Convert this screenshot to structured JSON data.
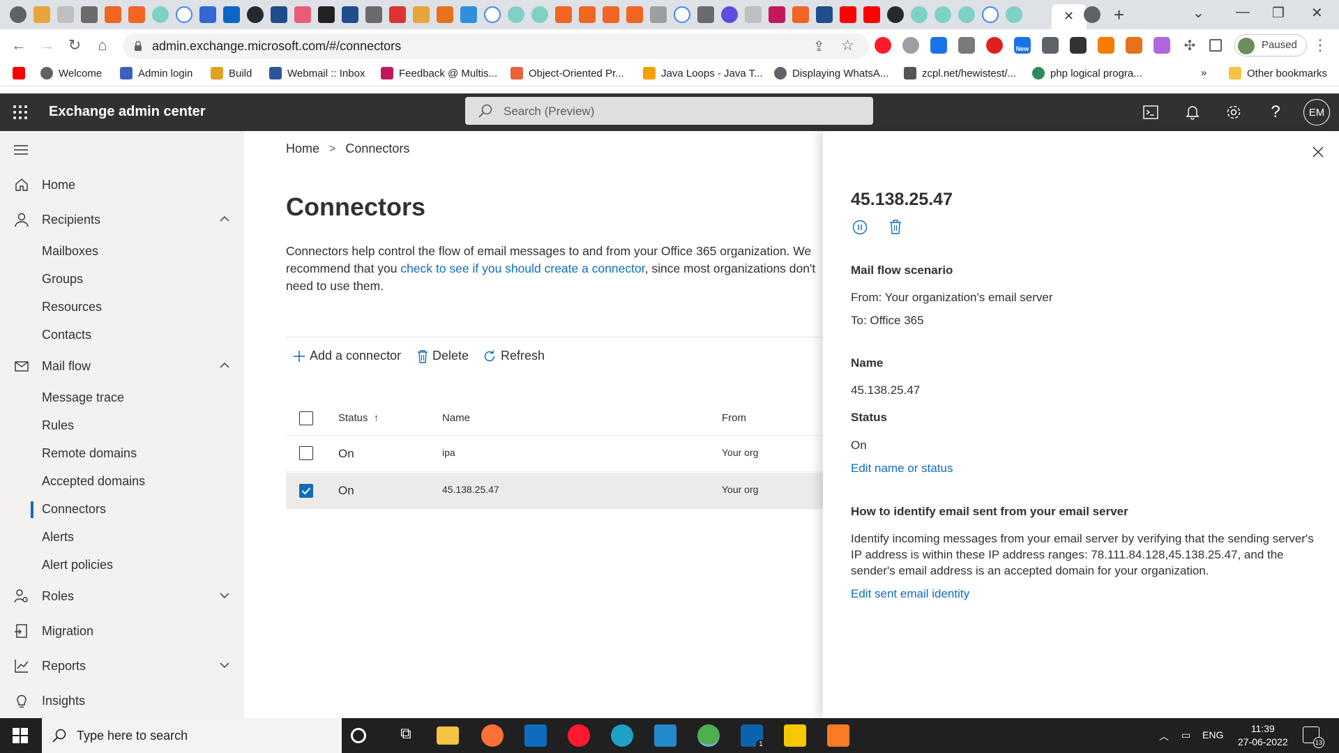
{
  "browser": {
    "url": "admin.exchange.microsoft.com/#/connectors",
    "profile_status": "Paused",
    "bookmarks": [
      {
        "label": "Welcome"
      },
      {
        "label": "Admin login"
      },
      {
        "label": "Build"
      },
      {
        "label": "Webmail :: Inbox"
      },
      {
        "label": "Feedback @ Multis..."
      },
      {
        "label": "Object-Oriented Pr..."
      },
      {
        "label": "Java Loops - Java T..."
      },
      {
        "label": "Displaying WhatsA..."
      },
      {
        "label": "zcpl.net/hewistest/..."
      },
      {
        "label": "php logical progra..."
      }
    ],
    "bookmarks_overflow": "»",
    "other_bookmarks": "Other bookmarks",
    "extension_badge": "New"
  },
  "header": {
    "app_title": "Exchange admin center",
    "search_placeholder": "Search (Preview)",
    "avatar_initials": "EM"
  },
  "nav": {
    "items": [
      {
        "label": "Home"
      },
      {
        "label": "Recipients"
      },
      {
        "label": "Mailboxes"
      },
      {
        "label": "Groups"
      },
      {
        "label": "Resources"
      },
      {
        "label": "Contacts"
      },
      {
        "label": "Mail flow"
      },
      {
        "label": "Message trace"
      },
      {
        "label": "Rules"
      },
      {
        "label": "Remote domains"
      },
      {
        "label": "Accepted domains"
      },
      {
        "label": "Connectors"
      },
      {
        "label": "Alerts"
      },
      {
        "label": "Alert policies"
      },
      {
        "label": "Roles"
      },
      {
        "label": "Migration"
      },
      {
        "label": "Reports"
      },
      {
        "label": "Insights"
      }
    ]
  },
  "main": {
    "breadcrumb": {
      "home": "Home",
      "current": "Connectors"
    },
    "title": "Connectors",
    "description_before": "Connectors help control the flow of email messages to and from your Office 365 organization. We recommend that you ",
    "description_link": "check to see if you should create a connector",
    "description_after": ", since most organizations don't need to use them.",
    "commands": {
      "add": "Add a connector",
      "delete": "Delete",
      "refresh": "Refresh"
    },
    "columns": {
      "status": "Status",
      "sort_arrow": "↑",
      "name": "Name",
      "from": "From"
    },
    "rows": [
      {
        "status": "On",
        "name": "ipa",
        "from": "Your org",
        "selected": false
      },
      {
        "status": "On",
        "name": "45.138.25.47",
        "from": "Your org",
        "selected": true
      }
    ]
  },
  "panel": {
    "title": "45.138.25.47",
    "mail_flow_heading": "Mail flow scenario",
    "from_line": "From: Your organization's email server",
    "to_line": "To: Office 365",
    "name_heading": "Name",
    "name_value": "45.138.25.47",
    "status_heading": "Status",
    "status_value": "On",
    "edit_name_link": "Edit name or status",
    "identify_heading": "How to identify email sent from your email server",
    "identify_text": "Identify incoming messages from your email server by verifying that the sending server's IP address is within these IP address ranges: 78.111.84.128,45.138.25.47, and the sender's email address is an accepted domain for your organization.",
    "edit_identity_link": "Edit sent email identity"
  },
  "taskbar": {
    "search_placeholder": "Type here to search",
    "language": "ENG",
    "time": "11:39",
    "date": "27-06-2022",
    "notification_count": "13",
    "mail_badge": "1"
  },
  "colors": {
    "accent": "#0f6cbd",
    "suite_bar": "#323130",
    "nav_bg": "#f3f2f1"
  }
}
